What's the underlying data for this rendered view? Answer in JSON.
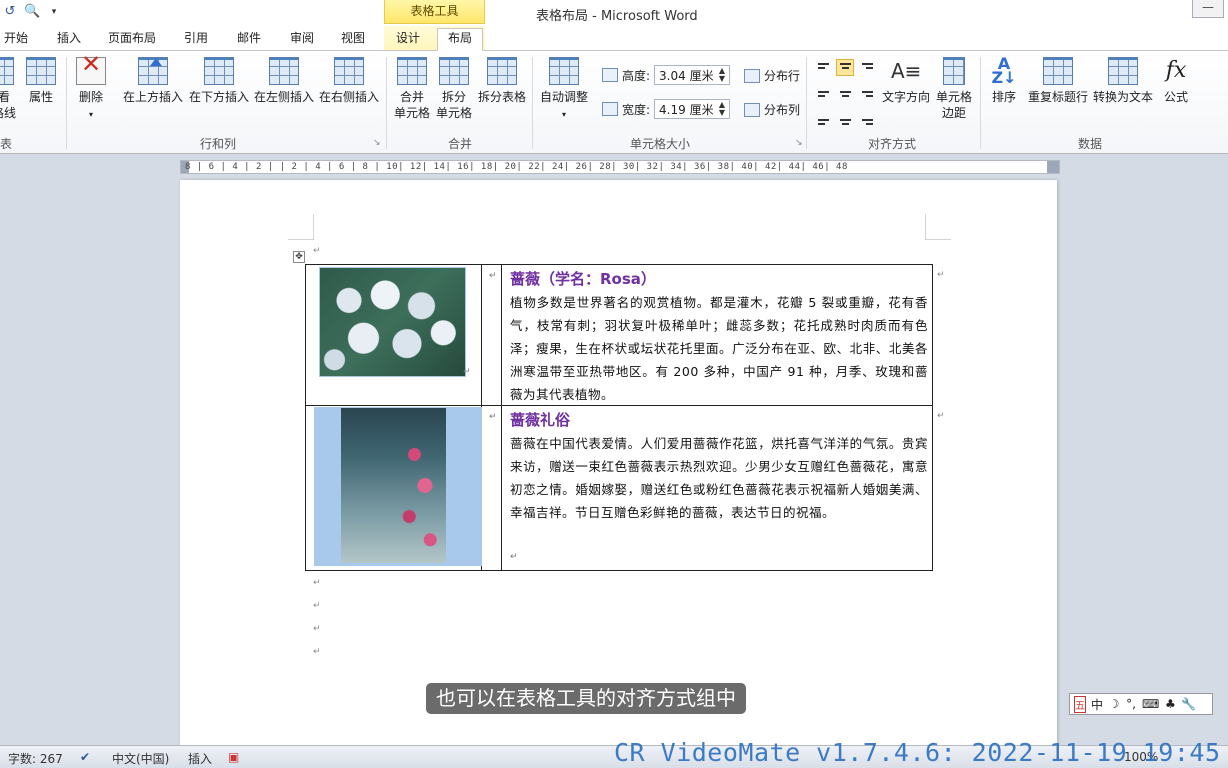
{
  "window": {
    "title": "表格布局 - Microsoft Word",
    "context_tab_group": "表格工具"
  },
  "tabs": [
    "开始",
    "插入",
    "页面布局",
    "引用",
    "邮件",
    "审阅",
    "视图",
    "设计",
    "布局"
  ],
  "active_tab": "布局",
  "ribbon": {
    "table_group_partial": {
      "view_gridlines": "查看\n网格线",
      "view_short1": "看",
      "view_short2": "格线",
      "properties": "属性",
      "label_tail": "表"
    },
    "rows_cols": {
      "label": "行和列",
      "delete": "删除",
      "insert_above": "在上方插入",
      "insert_below": "在下方插入",
      "insert_left": "在左侧插入",
      "insert_right": "在右侧插入"
    },
    "merge": {
      "label": "合并",
      "merge_cells_1": "合并",
      "merge_cells_2": "单元格",
      "split_cells_1": "拆分",
      "split_cells_2": "单元格",
      "split_table": "拆分表格"
    },
    "cell_size": {
      "label": "单元格大小",
      "autofit": "自动调整",
      "height_label": "高度:",
      "height_value": "3.04 厘米",
      "width_label": "宽度:",
      "width_value": "4.19 厘米",
      "distribute_rows": "分布行",
      "distribute_cols": "分布列"
    },
    "alignment": {
      "label": "对齐方式",
      "text_direction": "文字方向",
      "cell_margins_1": "单元格",
      "cell_margins_2": "边距"
    },
    "data": {
      "label": "数据",
      "sort": "排序",
      "repeat_header": "重复标题行",
      "convert_text": "转换为文本",
      "formula": "公式",
      "formula_glyph": "fx"
    }
  },
  "ruler": {
    "text": "8 |  6 |  4 |  2 |       | 2 |  4 |  6 |  8 |  10|  12|  14|  16|  18|  20|  22|  24|  26|  28|  30|  32|  34|  36|  38|  40|  42|  44|  46|  48"
  },
  "document": {
    "row1": {
      "title": "蔷薇（学名：Rosa）",
      "body": "植物多数是世界著名的观赏植物。都是灌木，花瓣 5 裂或重瓣，花有香气，枝常有刺；羽状复叶极稀单叶；雌蕊多数；花托成熟时肉质而有色泽；瘦果，生在杯状或坛状花托里面。广泛分布在亚、欧、北非、北美各洲寒温带至亚热带地区。有 200 多种，中国产 91 种，月季、玫瑰和蔷薇为其代表植物。"
    },
    "row2": {
      "title": "蔷薇礼俗",
      "body": "蔷薇在中国代表爱情。人们爱用蔷薇作花篮，烘托喜气洋洋的气氛。贵宾来访，赠送一束红色蔷薇表示热烈欢迎。少男少女互赠红色蔷薇花，寓意初恋之情。婚姻嫁娶，赠送红色或粉红色蔷薇花表示祝福新人婚姻美满、幸福吉祥。节日互赠色彩鲜艳的蔷薇，表达节日的祝福。"
    },
    "para_mark": "↵"
  },
  "subtitle": "也可以在表格工具的对齐方式组中",
  "ime": [
    "五",
    "中",
    "☽",
    "°,",
    "⌨",
    "♣",
    "🔧"
  ],
  "statusbar": {
    "word_count": "字数: 267",
    "language": "中文(中国)",
    "insert_mode": "插入",
    "zoom": "100%"
  },
  "watermark": "CR VideoMate v1.7.4.6: 2022-11-19 19:45",
  "colors": {
    "heading_purple": "#7030a0",
    "context_yellow": "#ffe66b",
    "watermark_blue": "#2a6fc0"
  }
}
